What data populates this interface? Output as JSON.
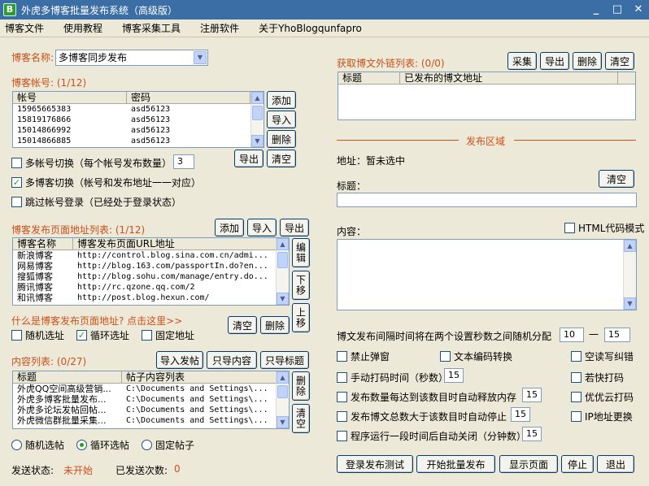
{
  "window": {
    "title": "外虎多博客批量发布系统（高级版）",
    "icon": "B",
    "min": "_",
    "max": "□",
    "close": "✕"
  },
  "menu": [
    "博客文件",
    "使用教程",
    "博客采集工具",
    "注册软件",
    "关于YhoBlogqunfapro"
  ],
  "blog_name": {
    "label": "博客名称:",
    "value": "多博客同步发布"
  },
  "accounts": {
    "label": "博客帐号:",
    "count": "(1/12)",
    "col1": "帐号",
    "col2": "密码",
    "rows": [
      [
        "15965665383",
        "asd56123"
      ],
      [
        "15819176866",
        "asd56123"
      ],
      [
        "15014866992",
        "asd56123"
      ],
      [
        "15014866885",
        "asd56123"
      ]
    ],
    "btn_add": "添加",
    "btn_import": "导入",
    "btn_delete": "删除",
    "btn_export": "导出",
    "btn_clear": "清空",
    "switch_label": "多帐号切换（每个帐号发布数量）",
    "switch_value": "3",
    "multi_blog_label": "多博客切换（帐号和发布地址一一对应）",
    "skip_login_label": "跳过帐号登录（已经处于登录状态）"
  },
  "pages": {
    "label": "博客发布页面地址列表:",
    "count": "(1/12)",
    "btn_add": "添加",
    "btn_import": "导入",
    "btn_export": "导出",
    "col1": "博客名称",
    "col2": "博客发布页面URL地址",
    "rows": [
      [
        "新浪博客",
        "http://control.blog.sina.com.cn/admi..."
      ],
      [
        "网易博客",
        "http://blog.163.com/passportIn.do?en..."
      ],
      [
        "搜狐博客",
        "http://blog.sohu.com/manage/entry.do..."
      ],
      [
        "腾讯博客",
        "http://rc.qzone.qq.com/2"
      ],
      [
        "和讯博客",
        "http://post.blog.hexun.com/"
      ]
    ],
    "btn_edit": "编辑",
    "btn_down": "下移",
    "btn_up": "上移",
    "help_link": "什么是博客发布页面地址? 点击这里>>",
    "btn_clear": "清空",
    "btn_delete": "删除",
    "opt_random": "随机选址",
    "opt_loop": "循环选址",
    "opt_fixed": "固定地址"
  },
  "content": {
    "label": "内容列表:",
    "count": "(0/27)",
    "btn_import_post": "导入发帖",
    "btn_import_content": "只导内容",
    "btn_import_title": "只导标题",
    "col1": "标题",
    "col2": "帖子内容列表",
    "rows": [
      [
        "外虎QQ空间高级营销...",
        "C:\\Documents and Settings\\..."
      ],
      [
        "外虎多博客批量发布...",
        "C:\\Documents and Settings\\..."
      ],
      [
        "外虎多论坛发帖回帖...",
        "C:\\Documents and Settings\\..."
      ],
      [
        "外虎微信群批量采集...",
        "C:\\Documents and Settings\\..."
      ]
    ],
    "btn_delete": "删除",
    "btn_clear": "清空",
    "opt_random": "随机选帖",
    "opt_loop": "循环选帖",
    "opt_fixed": "固定帖子"
  },
  "status": {
    "label": "发送状态:",
    "value": "未开始",
    "sent_label": "已发送次数:",
    "sent_value": "0"
  },
  "links": {
    "label": "获取博文外链列表:",
    "count": "(0/0)",
    "btn_collect": "采集",
    "btn_export": "导出",
    "btn_delete": "删除",
    "btn_clear": "清空",
    "col1": "标题",
    "col2": "已发布的博文地址"
  },
  "publish": {
    "section": "发布区域",
    "address": "地址：暂未选中",
    "title_label": "标题：",
    "btn_clear": "清空",
    "content_label": "内容：",
    "html_mode": "HTML代码模式",
    "interval_label": "博文发布间隔时间将在两个设置秒数之间随机分配",
    "interval_min": "10",
    "interval_dash": "一",
    "interval_max": "15"
  },
  "options": {
    "no_popup": "禁止弹窗",
    "text_encoding": "文本编码转换",
    "empty_read": "空读写纠错",
    "manual_typing": "手动打码时间（秒数）",
    "manual_typing_value": "15",
    "ruokuai": "若快打码",
    "release_memory": "发布数量每达到该数目时自动释放内存",
    "release_memory_value": "15",
    "youyou": "优优云打码",
    "auto_stop": "发布博文总数大于该数目时自动停止",
    "auto_stop_value": "15",
    "ip_change": "IP地址更换",
    "auto_close": "程序运行一段时间后自动关闭（分钟数）",
    "auto_close_value": "15"
  },
  "bottom_buttons": {
    "login_test": "登录发布测试",
    "start": "开始批量发布",
    "show_page": "显示页面",
    "stop": "停止",
    "exit": "退出"
  }
}
